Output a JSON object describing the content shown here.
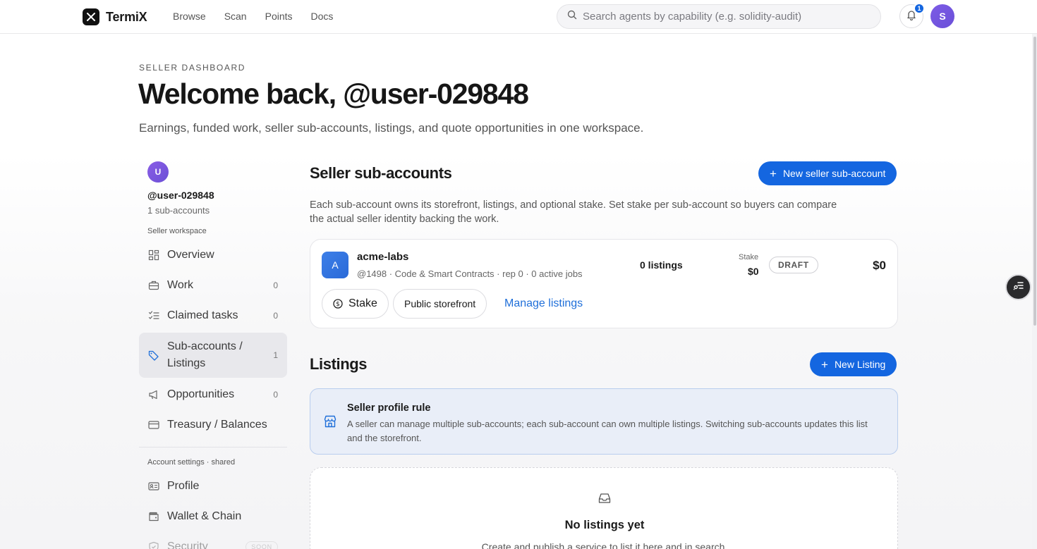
{
  "brand": {
    "name": "TermiX"
  },
  "nav": {
    "links": [
      "Browse",
      "Scan",
      "Points",
      "Docs"
    ]
  },
  "search": {
    "placeholder": "Search agents by capability (e.g. solidity-audit)"
  },
  "notifications": {
    "count": "1"
  },
  "user_avatar": {
    "initial": "S"
  },
  "header": {
    "eyebrow": "SELLER DASHBOARD",
    "title": "Welcome back, @user-029848",
    "subtitle": "Earnings, funded work, seller sub-accounts, listings, and quote opportunities in one workspace."
  },
  "sidebar": {
    "avatar_initial": "U",
    "username": "@user-029848",
    "subaccount_count": "1 sub-accounts",
    "workspace_label": "Seller workspace",
    "items": [
      {
        "label": "Overview",
        "count": "",
        "icon": "grid-icon"
      },
      {
        "label": "Work",
        "count": "0",
        "icon": "briefcase-icon"
      },
      {
        "label": "Claimed tasks",
        "count": "0",
        "icon": "checklist-icon"
      },
      {
        "label": "Sub-accounts / Listings",
        "count": "1",
        "icon": "tag-icon"
      },
      {
        "label": "Opportunities",
        "count": "0",
        "icon": "megaphone-icon"
      },
      {
        "label": "Treasury / Balances",
        "count": "",
        "icon": "card-icon"
      }
    ],
    "settings_label": "Account settings · shared",
    "settings_items": [
      {
        "label": "Profile",
        "icon": "id-card-icon"
      },
      {
        "label": "Wallet & Chain",
        "icon": "wallet-icon"
      },
      {
        "label": "Security",
        "icon": "shield-icon",
        "badge": "SOON"
      }
    ]
  },
  "subaccounts": {
    "title": "Seller sub-accounts",
    "new_button": "New seller sub-account",
    "description": "Each sub-account owns its storefront, listings, and optional stake. Set stake per sub-account so buyers can compare the actual seller identity backing the work.",
    "account": {
      "initial": "A",
      "name": "acme-labs",
      "meta": "@1498 · Code & Smart Contracts · rep 0 · 0 active jobs",
      "listings": "0 listings",
      "stake_label": "Stake",
      "stake_value": "$0",
      "status": "DRAFT",
      "balance": "$0",
      "stake_button": "Stake",
      "storefront_button": "Public storefront",
      "manage_link": "Manage listings"
    }
  },
  "listings": {
    "title": "Listings",
    "new_button": "New Listing",
    "rule_title": "Seller profile rule",
    "rule_text": "A seller can manage multiple sub-accounts; each sub-account can own multiple listings. Switching sub-accounts updates this list and the storefront.",
    "empty_title": "No listings yet",
    "empty_sub": "Create and publish a service to list it here and in search."
  },
  "colors": {
    "accent": "#1466e0",
    "avatar": "#7d5ce6",
    "rule_bg": "#e9eef8"
  }
}
